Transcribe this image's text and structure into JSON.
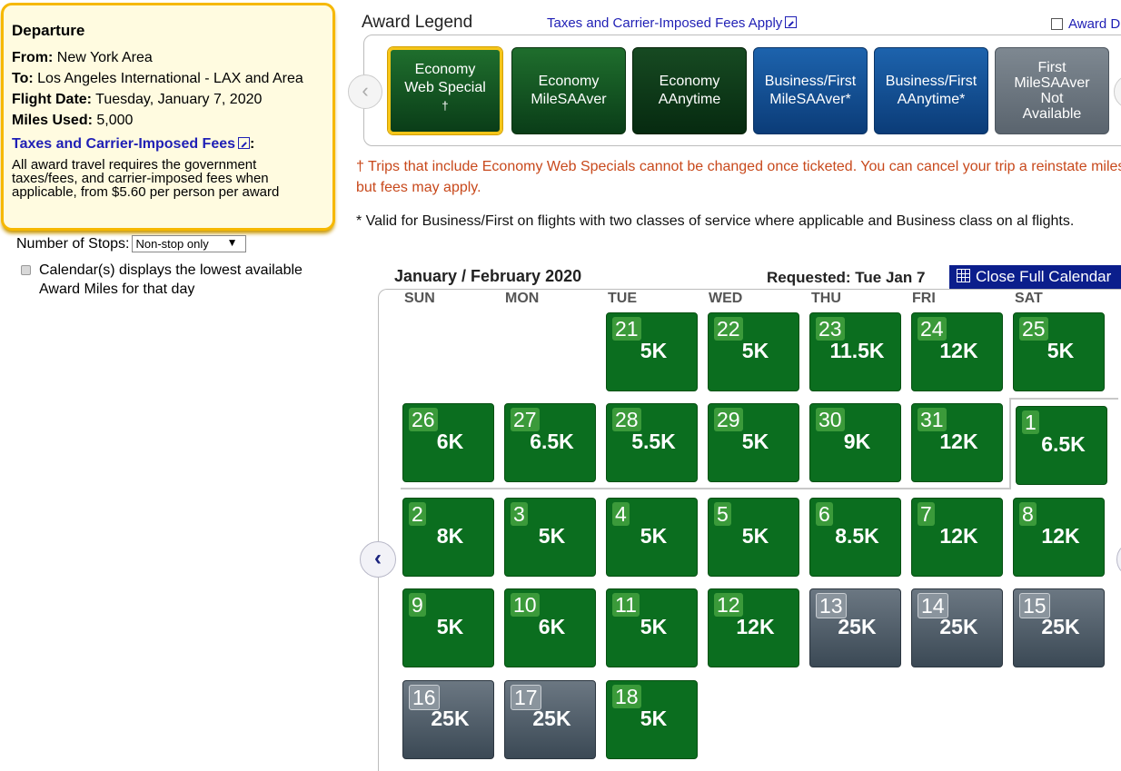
{
  "departure": {
    "title": "Departure",
    "from_label": "From:",
    "from_value": "New York Area",
    "to_label": "To:",
    "to_value": "Los Angeles International - LAX and Area",
    "date_label": "Flight Date:",
    "date_value": "Tuesday, January 7, 2020",
    "miles_label": "Miles Used:",
    "miles_value": "5,000",
    "fees_link": "Taxes and Carrier-Imposed Fees",
    "fees_colon": ":",
    "fees_note": "All award travel requires the government taxes/fees, and carrier-imposed fees when applicable, from $5.60 per person per award"
  },
  "stops": {
    "label": "Number of Stops:",
    "selected": "Non-stop only"
  },
  "calendar_note": "Calendar(s) displays the lowest available Award Miles for that day",
  "legend": {
    "title": "Award Legend",
    "taxes_link": "Taxes and Carrier-Imposed Fees Apply",
    "award_link": "Award D",
    "tiles": [
      {
        "line1": "Economy",
        "line2": "Web Special",
        "mark": "†"
      },
      {
        "line1": "Economy",
        "line2": "MileSAAver"
      },
      {
        "line1": "Economy",
        "line2": "AAnytime"
      },
      {
        "line1": "Business/First",
        "line2": "MileSAAver*"
      },
      {
        "line1": "Business/First",
        "line2": "AAnytime*"
      },
      {
        "line1": "First",
        "line2": "MileSAAver",
        "line3": "Not",
        "line4": "Available"
      }
    ]
  },
  "notices": {
    "red": "† Trips that include Economy Web Specials cannot be changed once ticketed. You can cancel your trip a reinstate miles, but fees may apply.",
    "black": "* Valid for Business/First on flights with two classes of service where applicable and Business class on al flights."
  },
  "calendar": {
    "title": "January / February 2020",
    "requested": "Requested: Tue Jan 7",
    "close_button": "Close Full Calendar",
    "weekdays": [
      "SUN",
      "MON",
      "TUE",
      "WED",
      "THU",
      "FRI",
      "SAT"
    ],
    "weeks": [
      [
        null,
        null,
        {
          "d": "21",
          "m": "5K",
          "t": "g"
        },
        {
          "d": "22",
          "m": "5K",
          "t": "g"
        },
        {
          "d": "23",
          "m": "11.5K",
          "t": "g"
        },
        {
          "d": "24",
          "m": "12K",
          "t": "g"
        },
        {
          "d": "25",
          "m": "5K",
          "t": "g"
        }
      ],
      [
        {
          "d": "26",
          "m": "6K",
          "t": "g"
        },
        {
          "d": "27",
          "m": "6.5K",
          "t": "g"
        },
        {
          "d": "28",
          "m": "5.5K",
          "t": "g"
        },
        {
          "d": "29",
          "m": "5K",
          "t": "g"
        },
        {
          "d": "30",
          "m": "9K",
          "t": "g"
        },
        {
          "d": "31",
          "m": "12K",
          "t": "g"
        },
        {
          "d": "1",
          "m": "6.5K",
          "t": "g"
        }
      ],
      [
        {
          "d": "2",
          "m": "8K",
          "t": "g"
        },
        {
          "d": "3",
          "m": "5K",
          "t": "g"
        },
        {
          "d": "4",
          "m": "5K",
          "t": "g"
        },
        {
          "d": "5",
          "m": "5K",
          "t": "g"
        },
        {
          "d": "6",
          "m": "8.5K",
          "t": "g"
        },
        {
          "d": "7",
          "m": "12K",
          "t": "g"
        },
        {
          "d": "8",
          "m": "12K",
          "t": "g"
        }
      ],
      [
        {
          "d": "9",
          "m": "5K",
          "t": "g"
        },
        {
          "d": "10",
          "m": "6K",
          "t": "g"
        },
        {
          "d": "11",
          "m": "5K",
          "t": "g"
        },
        {
          "d": "12",
          "m": "12K",
          "t": "g"
        },
        {
          "d": "13",
          "m": "25K",
          "t": "s"
        },
        {
          "d": "14",
          "m": "25K",
          "t": "s"
        },
        {
          "d": "15",
          "m": "25K",
          "t": "s"
        }
      ],
      [
        {
          "d": "16",
          "m": "25K",
          "t": "s"
        },
        {
          "d": "17",
          "m": "25K",
          "t": "s"
        },
        {
          "d": "18",
          "m": "5K",
          "t": "g"
        },
        null,
        null,
        null,
        null
      ]
    ]
  }
}
